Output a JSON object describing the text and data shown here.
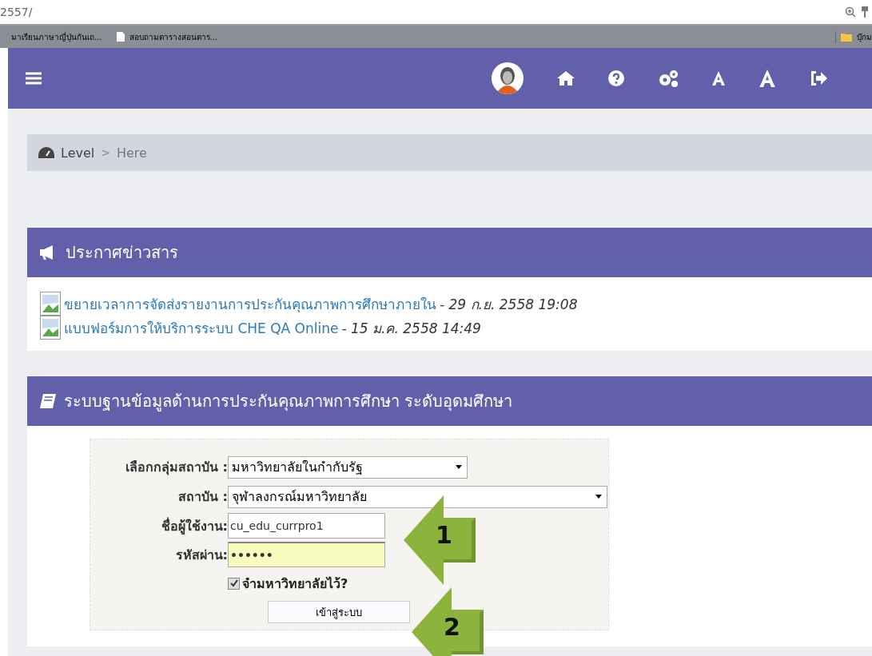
{
  "browser": {
    "url": "2557/",
    "bookmarks": [
      {
        "label": "มาเรียนภาษาญี่ปุ่นกันเถ...",
        "kind": "plain"
      },
      {
        "label": "สอบถามตารางสอนตาร...",
        "kind": "page"
      },
      {
        "label": "บุ๊กม",
        "kind": "folder"
      }
    ]
  },
  "breadcrumb": {
    "items": [
      "Level",
      "Here"
    ],
    "separator": ">"
  },
  "news": {
    "title": "ประกาศข่าวสาร",
    "items": [
      {
        "link": "ขยายเวลาการจัดส่งรายงานการประกันคุณภาพการศึกษาภายใน",
        "date": "- 29 *ก.ย.* 2558 19:08"
      },
      {
        "link": "แบบฟอร์มการให้บริการระบบ CHE QA Online",
        "date": "- 15 *ม.ค.* 2558 14:49"
      }
    ]
  },
  "login": {
    "title": "ระบบฐานข้อมูลด้านการประกันคุณภาพการศึกษา ระดับอุดมศึกษา",
    "group_label": "เลือกกลุ่มสถาบัน :",
    "group_value": "มหาวิทยาลัยในกำกับรัฐ",
    "inst_label": "สถาบัน :",
    "inst_value": "จุฬาลงกรณ์มหาวิทยาลัย",
    "user_label": "ชื่อผู้ใช้งาน:",
    "user_value": "cu_edu_currpro1",
    "pass_label": "รหัสผ่าน:",
    "pass_value": "••••••",
    "remember": {
      "label": "จำมหาวิทยาลัยไว้?",
      "checked": true
    },
    "submit": "เข้าสู่ระบบ"
  },
  "callouts": [
    "1",
    "2"
  ]
}
